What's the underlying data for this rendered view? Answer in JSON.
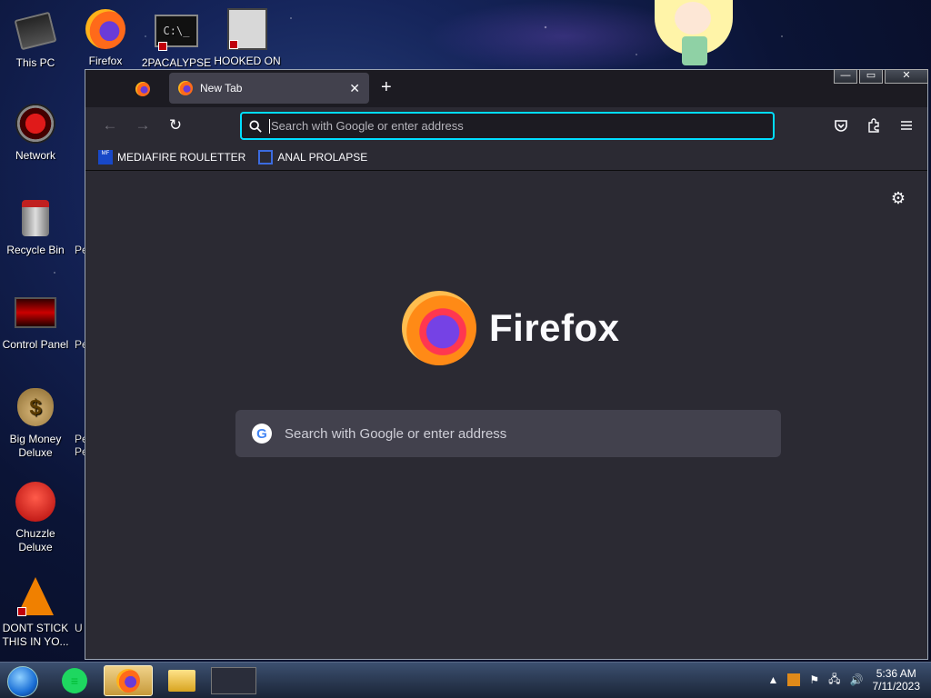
{
  "desktop": {
    "icons": [
      {
        "label": "This PC",
        "icon": "computer-icon"
      },
      {
        "label": "Firefox",
        "icon": "firefox-icon"
      },
      {
        "label": "2PACALYPSE",
        "icon": "console-icon"
      },
      {
        "label": "HOOKED ON",
        "icon": "game-icon"
      },
      {
        "label": "Network",
        "icon": "network-icon"
      },
      {
        "label": "Recycle Bin",
        "icon": "recycle-bin-icon"
      },
      {
        "label": "Control Panel",
        "icon": "control-panel-icon"
      },
      {
        "label": "Big Money Deluxe",
        "icon": "money-bag-icon"
      },
      {
        "label": "Chuzzle Deluxe",
        "icon": "chuzzle-icon"
      },
      {
        "label": "DONT STICK THIS IN YO...",
        "icon": "vlc-cone-icon"
      }
    ],
    "peek_labels": [
      "Peg",
      "Peg",
      "Peg",
      "Peg of",
      "",
      "U"
    ]
  },
  "browser": {
    "tab": {
      "title": "New Tab"
    },
    "new_tab_symbol": "+",
    "window_buttons": {
      "minimize": "—",
      "maximize": "▭",
      "close": "✕"
    },
    "nav": {
      "back": "←",
      "forward": "→",
      "reload": "↻"
    },
    "urlbar": {
      "placeholder": "Search with Google or enter address"
    },
    "toolbar_icons": [
      "pocket-icon",
      "extensions-icon",
      "menu-icon"
    ],
    "bookmarks": [
      {
        "label": "MEDIAFIRE ROULETTER",
        "icon_text": "MF"
      },
      {
        "label": "ANAL PROLAPSE",
        "icon_text": ""
      }
    ],
    "newtab": {
      "brand": "Firefox",
      "search_placeholder": "Search with Google or enter address",
      "google_letter": "G"
    }
  },
  "taskbar": {
    "apps": [
      "spotify-like-icon",
      "firefox-icon",
      "file-explorer-icon",
      "game-icon"
    ],
    "clock": {
      "time": "5:36 AM",
      "date": "7/11/2023"
    }
  },
  "colors": {
    "accent": "#00ddff",
    "content_bg": "#2b2a33",
    "tab_bg": "#42414d"
  }
}
